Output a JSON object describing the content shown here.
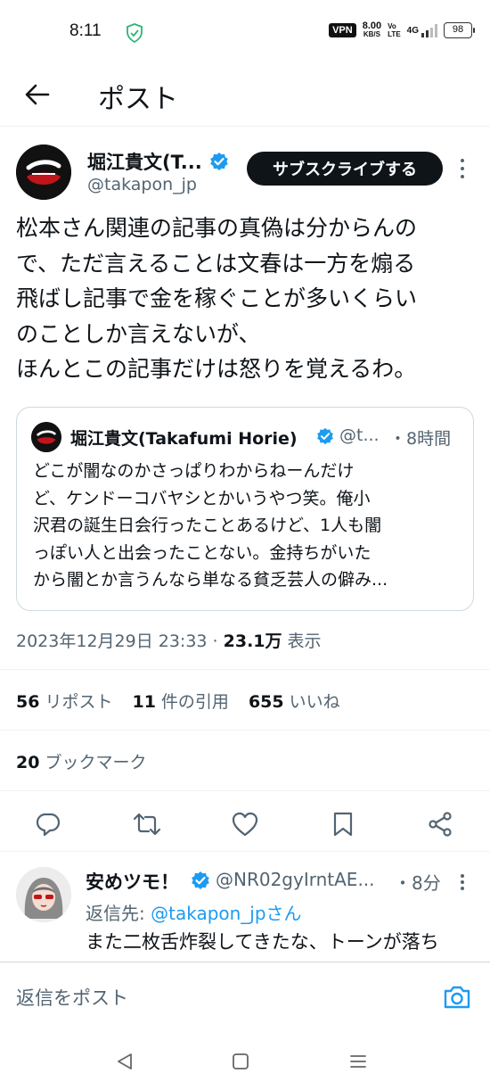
{
  "status_bar": {
    "time": "8:11",
    "vpn": "VPN",
    "speed_value": "8.00",
    "speed_unit": "KB/S",
    "volte_top": "Vo",
    "volte_bottom": "LTE",
    "network": "4G",
    "battery": "98"
  },
  "header": {
    "title": "ポスト"
  },
  "tweet": {
    "author_name": "堀江貴文(T...",
    "author_handle": "@takapon_jp",
    "subscribe_label": "サブスクライブする",
    "body_lines": [
      "松本さん関連の記事の真偽は分からんの",
      "で、ただ言えることは文春は一方を煽る",
      "飛ばし記事で金を稼ぐことが多いくらい",
      "のことしか言えないが、",
      "ほんとこの記事だけは怒りを覚えるわ。"
    ],
    "quote": {
      "name": "堀江貴文(Takafumi Horie)",
      "handle": "@t...",
      "time": "・8時間",
      "lines": [
        "どこが闇なのかさっぱりわからねーんだけ",
        "ど、ケンドーコバヤシとかいうやつ笑。俺小",
        "沢君の誕生日会行ったことあるけど、1人も闇",
        "っぽい人と出会ったことない。金持ちがいた",
        "から闇とか言うんなら単なる貧乏芸人の僻み..."
      ]
    },
    "date": "2023年12月29日 23:33 · ",
    "views_count": "23.1万",
    "views_label": " 表示",
    "stats": {
      "reposts_count": "56",
      "reposts_label": "リポスト",
      "quotes_count": "11",
      "quotes_label": "件の引用",
      "likes_count": "655",
      "likes_label": "いいね",
      "bookmarks_count": "20",
      "bookmarks_label": "ブックマーク"
    }
  },
  "reply": {
    "name": "安めツモ！",
    "handle": "@NR02gyIrntAE...",
    "time": "・8分",
    "reply_to_prefix": "返信先: ",
    "reply_to_user": "@takapon_jpさん",
    "text": "また二枚舌炸裂してきたな、トーンが落ち"
  },
  "compose": {
    "placeholder": "返信をポスト"
  },
  "colors": {
    "accent": "#1d9bf0",
    "text_primary": "#0f1419",
    "text_secondary": "#536471",
    "border": "#cfd9de"
  },
  "icons": {
    "back": "arrow-left-icon",
    "verified": "verified-badge-icon",
    "more": "more-vertical-icon",
    "reply": "reply-bubble-icon",
    "repost": "repost-icon",
    "like": "heart-icon",
    "bookmark": "bookmark-icon",
    "share": "share-icon",
    "camera": "camera-icon",
    "nav_back": "triangle-back-icon",
    "nav_home": "square-home-icon",
    "nav_menu": "menu-lines-icon"
  }
}
